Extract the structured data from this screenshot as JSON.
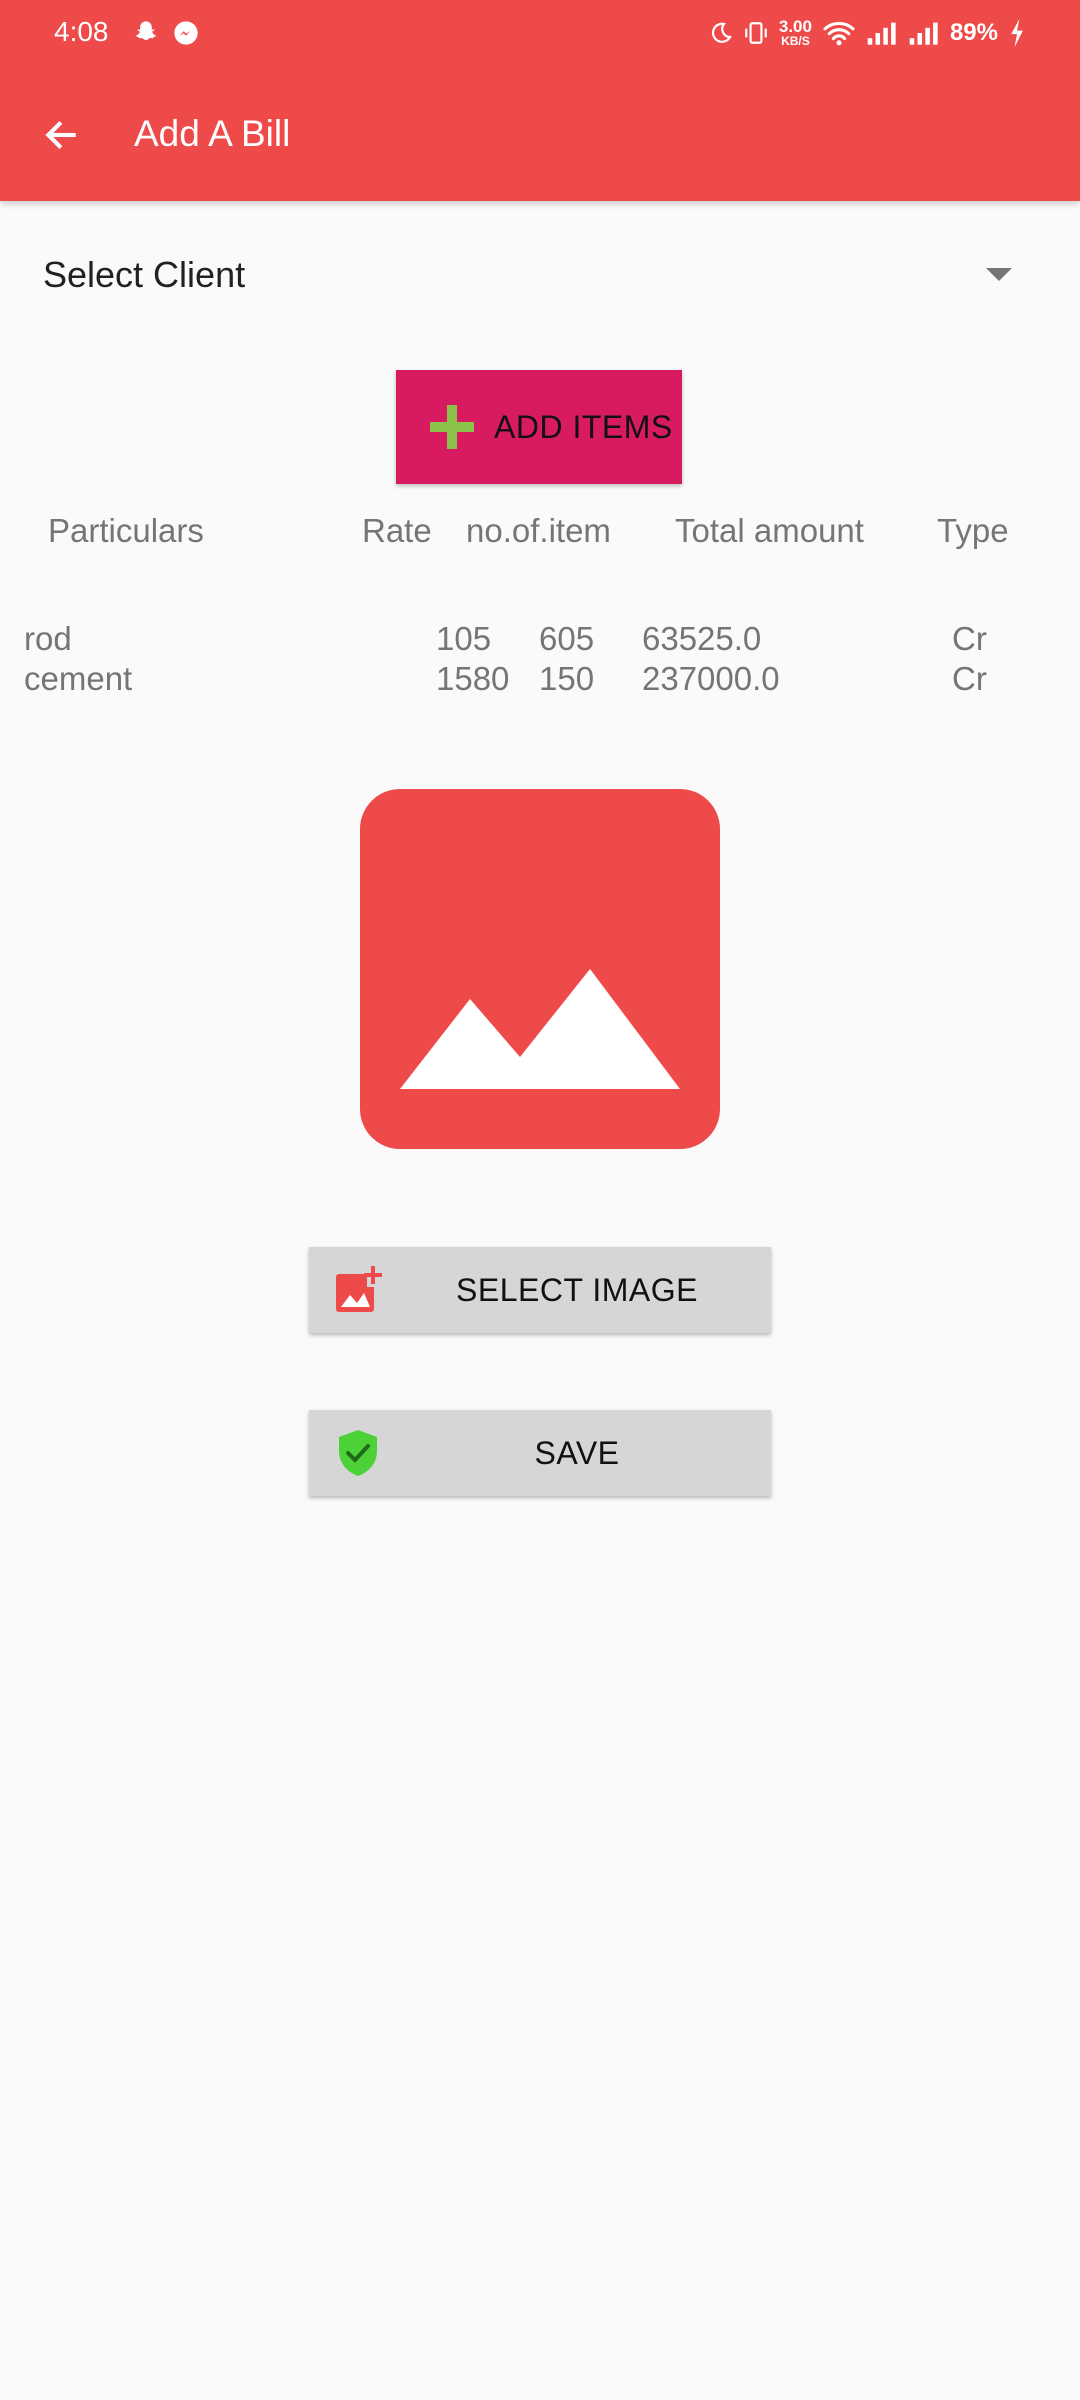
{
  "status_bar": {
    "time": "4:08",
    "net_speed": "3.00",
    "net_unit": "KB/S",
    "battery": "89%"
  },
  "toolbar": {
    "title": "Add A Bill",
    "back_icon": "arrow-back-icon"
  },
  "client_select": {
    "label": "Select Client"
  },
  "add_items_button": {
    "label": "ADD ITEMS",
    "icon": "plus-icon"
  },
  "table": {
    "headers": [
      "Particulars",
      "Rate",
      "no.of.item",
      "Total amount",
      "Type"
    ],
    "rows": [
      {
        "particular": "rod",
        "rate": "105",
        "count": "605",
        "total": "63525.0",
        "type": "Cr"
      },
      {
        "particular": "cement",
        "rate": "1580",
        "count": "150",
        "total": "237000.0",
        "type": "Cr"
      }
    ]
  },
  "image_placeholder": {
    "icon": "image-placeholder-icon"
  },
  "select_image_button": {
    "label": "SELECT IMAGE",
    "icon": "add-photo-icon"
  },
  "save_button": {
    "label": "SAVE",
    "icon": "verified-shield-icon"
  },
  "colors": {
    "primary": "#ef4a4a",
    "accent": "#d81b60",
    "plus": "#8bc34a",
    "shield": "#4cd137",
    "button_gray": "#d6d6d6"
  }
}
